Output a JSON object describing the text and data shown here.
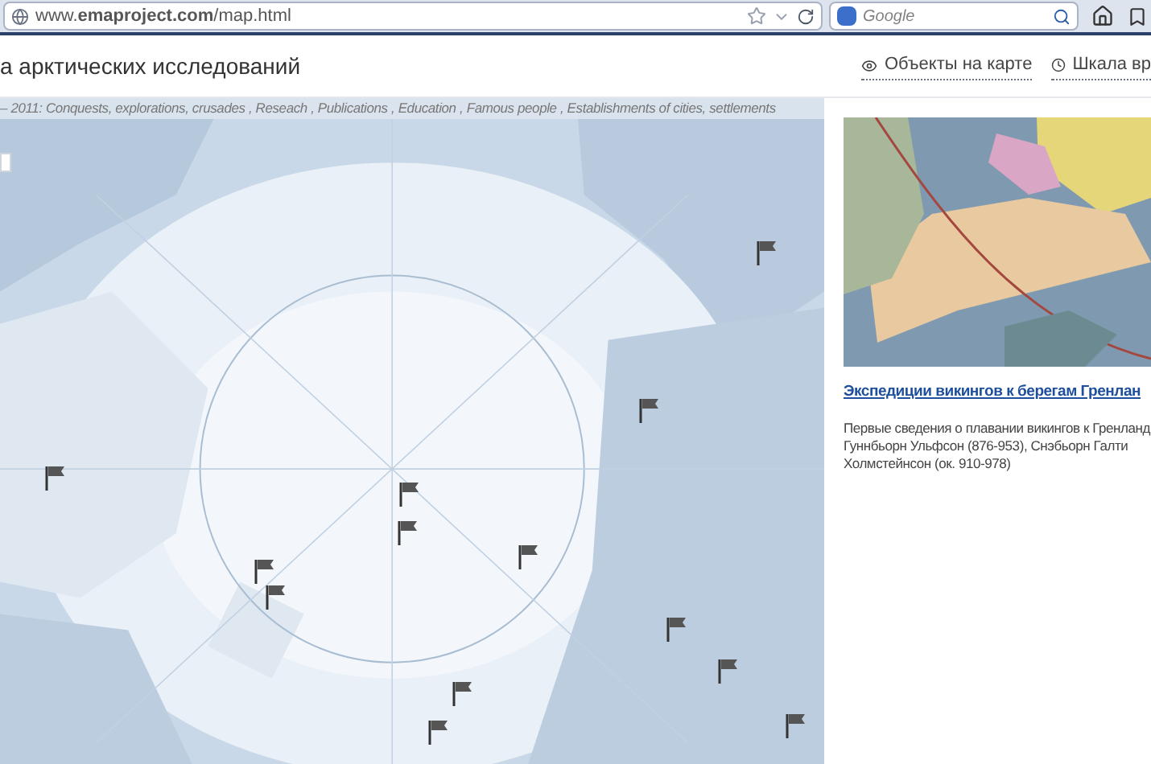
{
  "browser": {
    "url": "www.**emaproject.com**/map.html",
    "search": {
      "placeholder": "Google"
    }
  },
  "header": {
    "title": "а арктических исследований",
    "nav": [
      {
        "label": "Объекты на карте",
        "kind": "eye"
      },
      {
        "label": "Шкала вр",
        "kind": "clock"
      }
    ]
  },
  "map": {
    "filter_line": "– 2011: Conquests, explorations, crusades , Reseach , Publications , Education , Famous people , Establishments of cities, settlements"
  },
  "article": {
    "kind": "picture",
    "title": "Экспедиции викингов к берегам Гренлан",
    "text_lines": [
      "Первые сведения о плавании викингов к Гренланд",
      "Гуннбьорн Ульфсон (876-953), Снэбьорн Галти",
      "Холмстейнсон (ок. 910-978)"
    ]
  }
}
